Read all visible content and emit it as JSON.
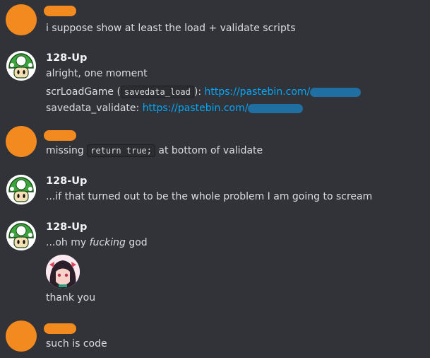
{
  "colors": {
    "background": "#313338",
    "text": "#dbdee1",
    "username": "#f2f3f5",
    "link": "#00a8fc",
    "redaction_orange": "#f28a20",
    "redaction_blue": "#1f6fa3"
  },
  "messages": [
    {
      "author_icon": "redacted-avatar",
      "text": "i suppose show at least the load + validate scripts"
    },
    {
      "author": "128-Up",
      "author_icon": "1up-mushroom-avatar",
      "text": "alright, one moment",
      "line2_prefix": "scrLoadGame (",
      "line2_code": "savedata_load",
      "line2_mid": "):",
      "line2_link": "https://pastebin.com/",
      "line3_prefix": "savedata_validate:",
      "line3_link": "https://pastebin.com/"
    },
    {
      "author_icon": "redacted-avatar",
      "text_prefix": "missing",
      "code": "return true;",
      "text_suffix": "at bottom of validate"
    },
    {
      "author": "128-Up",
      "author_icon": "1up-mushroom-avatar",
      "text": "...if that turned out to be the whole problem I am going to scream"
    },
    {
      "author": "128-Up",
      "author_icon": "1up-mushroom-avatar",
      "text_prefix": "...oh my",
      "text_emphasis": "fucking",
      "text_suffix": "god",
      "sticker_icon": "anime-girl-emoji",
      "text_after": "thank you"
    },
    {
      "author_icon": "redacted-avatar",
      "text": "such is code"
    }
  ]
}
